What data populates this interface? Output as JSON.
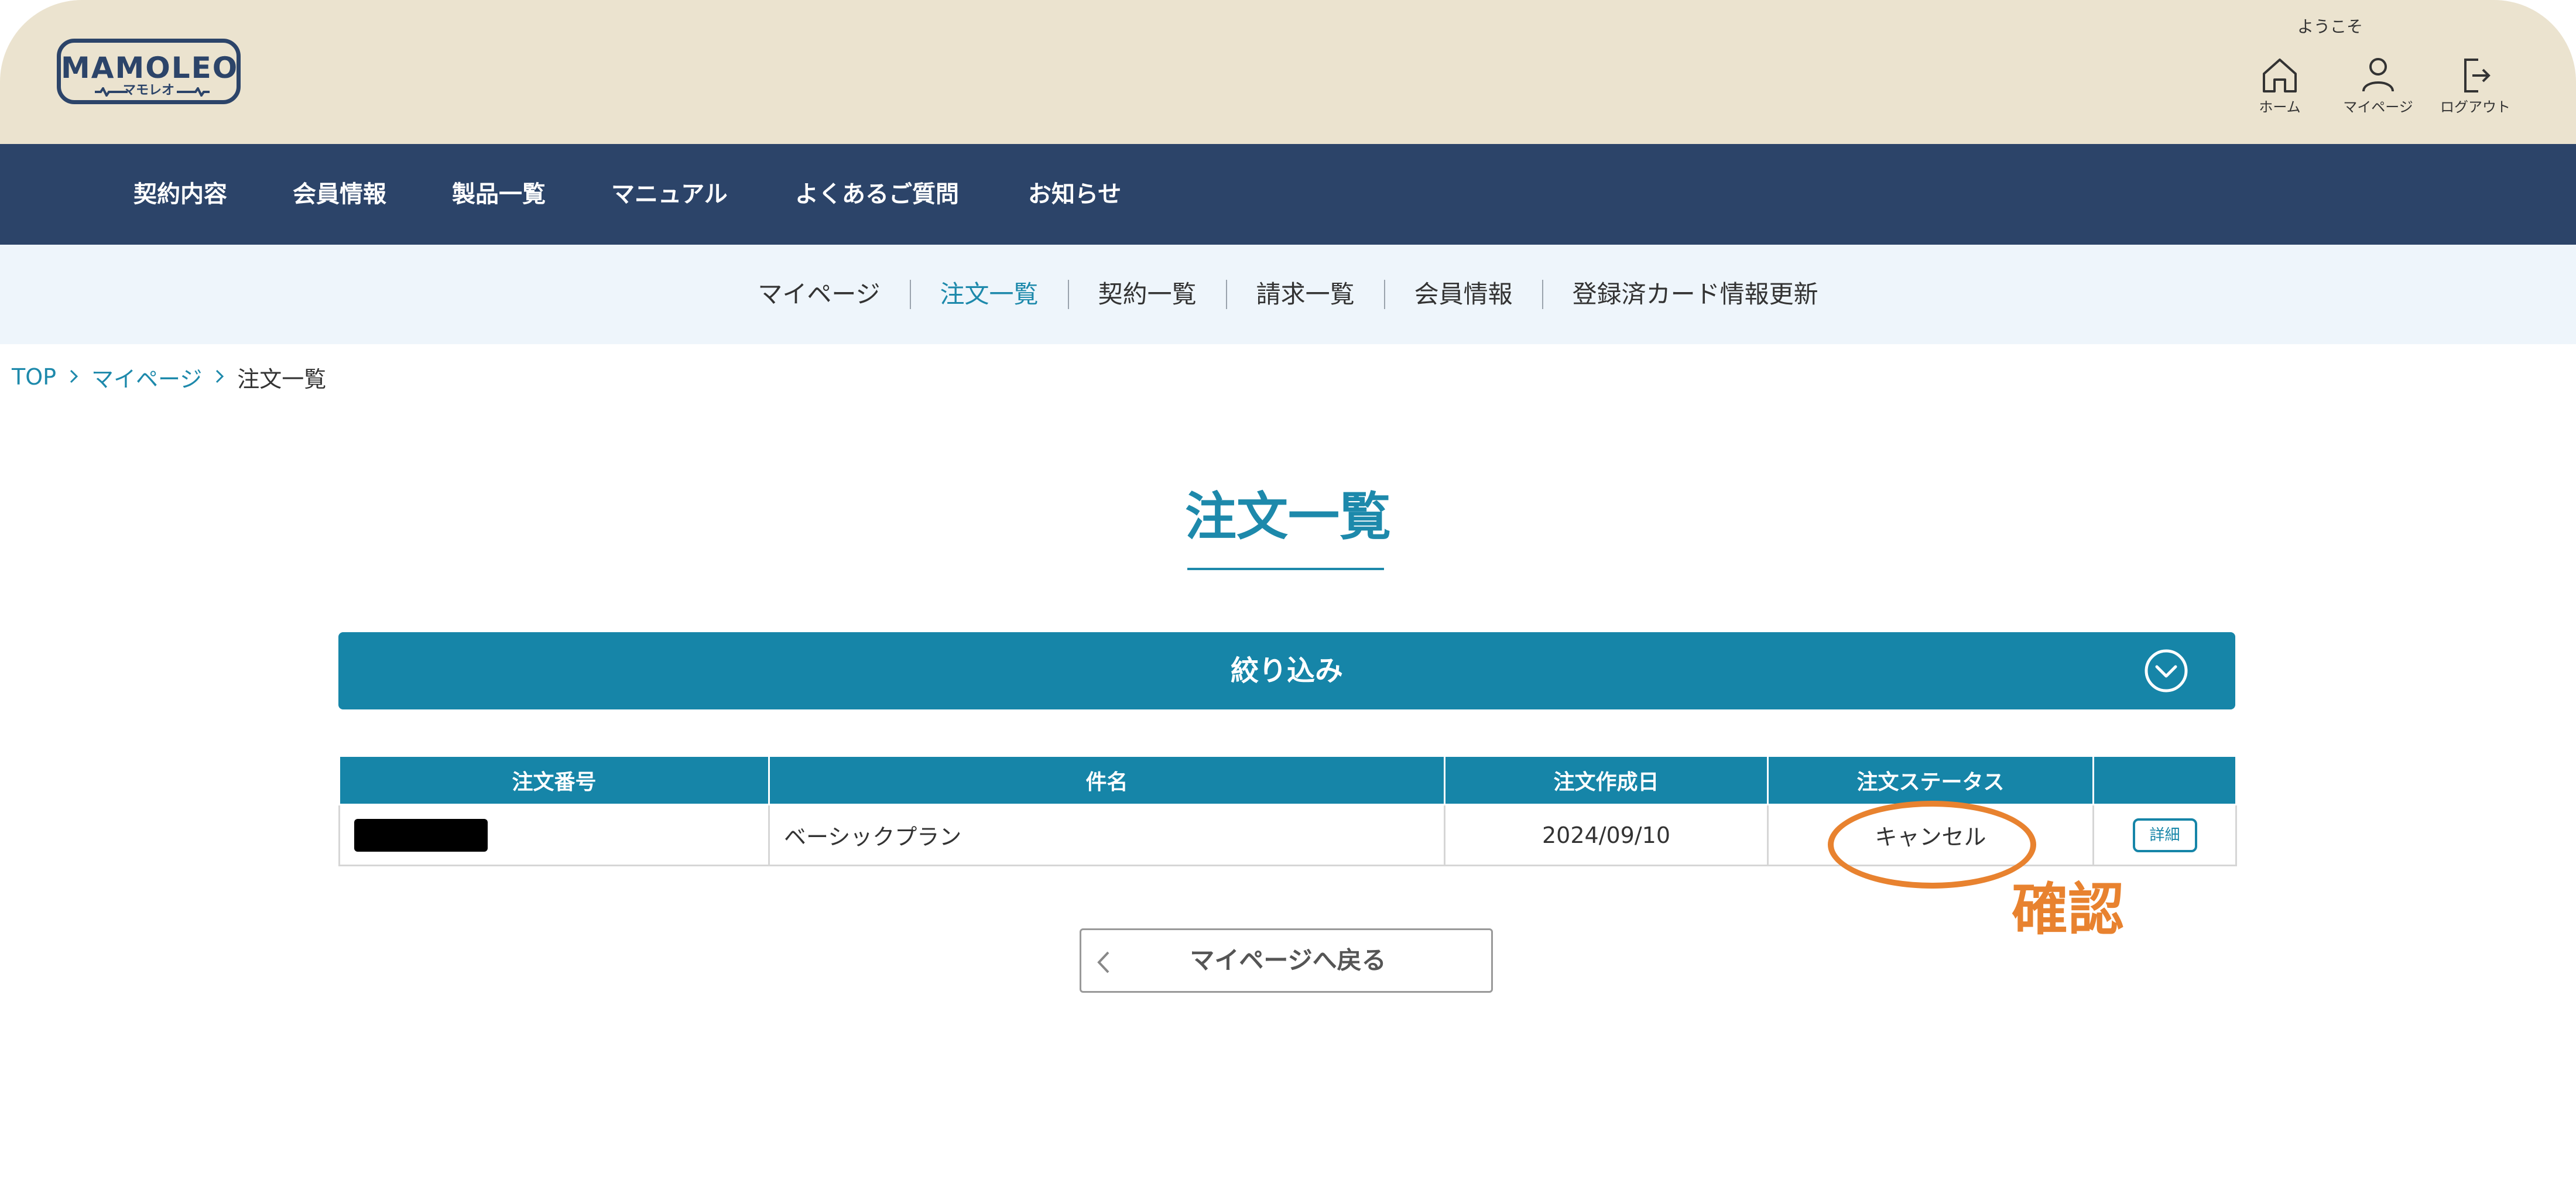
{
  "header": {
    "logo_text": "MAMOLEO",
    "logo_subtext": "マモレオ",
    "welcome": "ようこそ",
    "utility_nav": [
      {
        "label": "ホーム",
        "icon": "home-icon"
      },
      {
        "label": "マイページ",
        "icon": "user-icon"
      },
      {
        "label": "ログアウト",
        "icon": "logout-icon"
      }
    ]
  },
  "main_nav": {
    "items": [
      {
        "label": "契約内容"
      },
      {
        "label": "会員情報"
      },
      {
        "label": "製品一覧"
      },
      {
        "label": "マニュアル"
      },
      {
        "label": "よくあるご質問"
      },
      {
        "label": "お知らせ"
      }
    ]
  },
  "sub_nav": {
    "items": [
      {
        "label": "マイページ",
        "active": false
      },
      {
        "label": "注文一覧",
        "active": true
      },
      {
        "label": "契約一覧",
        "active": false
      },
      {
        "label": "請求一覧",
        "active": false
      },
      {
        "label": "会員情報",
        "active": false
      },
      {
        "label": "登録済カード情報更新",
        "active": false
      }
    ]
  },
  "breadcrumb": {
    "items": [
      {
        "label": "TOP"
      },
      {
        "label": "マイページ"
      },
      {
        "label": "注文一覧"
      }
    ]
  },
  "page": {
    "title": "注文一覧"
  },
  "filter": {
    "label": "絞り込み",
    "toggle_icon": "chevron-down-circle-icon"
  },
  "table": {
    "headers": [
      "注文番号",
      "件名",
      "注文作成日",
      "注文ステータス",
      ""
    ],
    "rows": [
      {
        "order_number": "",
        "subject": "ベーシックプラン",
        "created_date": "2024/09/10",
        "status": "キャンセル",
        "detail_label": "詳細"
      }
    ]
  },
  "annotation": {
    "text": "確認",
    "color": "#e8822f"
  },
  "back_button": {
    "label": "マイページへ戻る"
  },
  "colors": {
    "header_bg": "#ebe3cf",
    "nav_bg": "#2c4469",
    "subnav_bg": "#eef5fb",
    "accent": "#1685a8",
    "link": "#1d89ab"
  }
}
